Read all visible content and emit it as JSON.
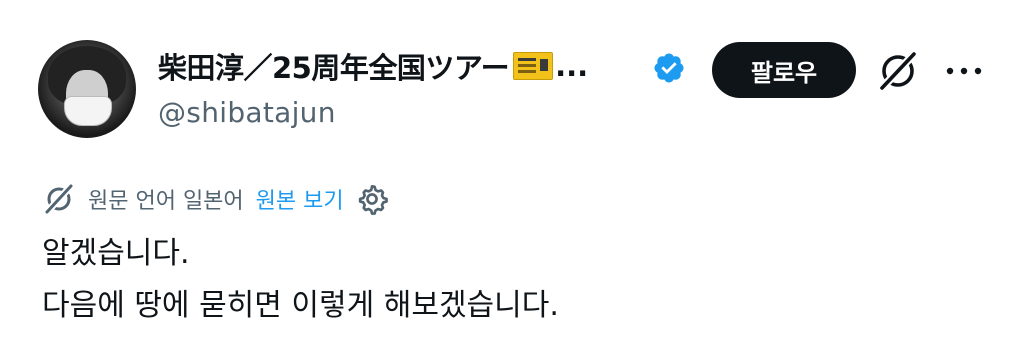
{
  "author": {
    "display_name": "柴田淳／25周年全国ツアー",
    "name_truncation": "...",
    "handle": "@shibatajun",
    "verified": true,
    "avatar": "avatar"
  },
  "actions": {
    "follow_label": "팔로우",
    "grok_icon": "grok-icon",
    "more_icon": "more-icon"
  },
  "translation": {
    "original_language_text": "원문 언어 일본어",
    "view_original_label": "원본 보기",
    "settings_icon": "gear-icon"
  },
  "tweet": {
    "line1": "알겠습니다.",
    "line2": "다음에 땅에 묻히면 이렇게 해보겠습니다."
  },
  "colors": {
    "text": "#0f1419",
    "secondary": "#536471",
    "link": "#1d9bf0",
    "verified": "#1d9bf0",
    "button_bg": "#0f1419"
  }
}
